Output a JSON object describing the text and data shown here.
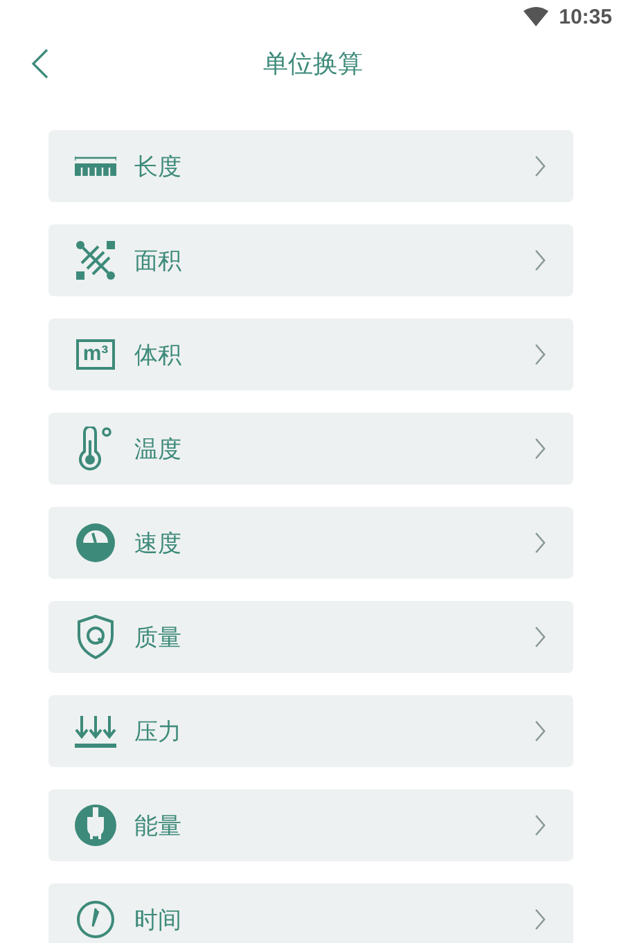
{
  "status_bar": {
    "time": "10:35"
  },
  "header": {
    "title": "单位换算"
  },
  "items": [
    {
      "kind": "length",
      "label": "长度"
    },
    {
      "kind": "area",
      "label": "面积"
    },
    {
      "kind": "volume",
      "label": "体积",
      "icon_text": "m³"
    },
    {
      "kind": "temperature",
      "label": "温度"
    },
    {
      "kind": "speed",
      "label": "速度"
    },
    {
      "kind": "mass",
      "label": "质量"
    },
    {
      "kind": "pressure",
      "label": "压力"
    },
    {
      "kind": "energy",
      "label": "能量"
    },
    {
      "kind": "time",
      "label": "时间"
    }
  ]
}
